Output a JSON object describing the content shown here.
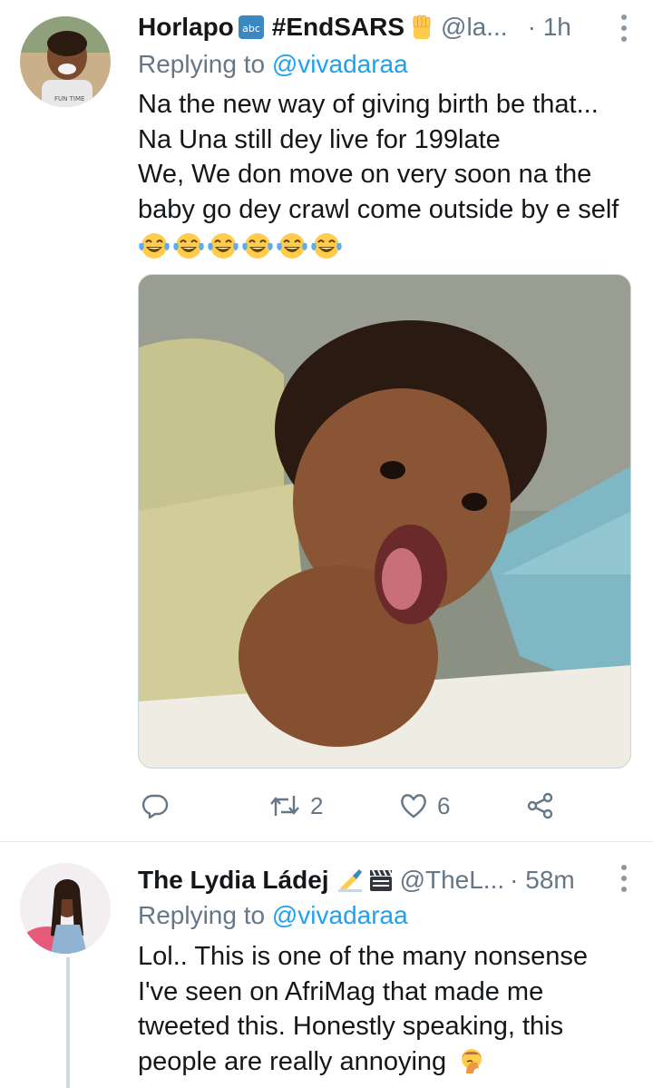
{
  "tweets": [
    {
      "author_name": "Horlapo",
      "name_badges": [
        "abc-icon",
        "raised-fist-icon"
      ],
      "hashtag": "#EndSARS",
      "handle": "@la...",
      "time": "· 1h",
      "replying_prefix": "Replying to",
      "replying_to": "@vivadaraa",
      "text_lines": [
        "Na the new way of giving birth be that...",
        "Na Una still dey live for 199late",
        "We, We don move on very soon na the",
        "baby go dey crawl come outside by e self"
      ],
      "emoji_row": [
        "tears-of-joy-emoji",
        "tears-of-joy-emoji",
        "tears-of-joy-emoji",
        "tears-of-joy-emoji",
        "tears-of-joy-emoji",
        "tears-of-joy-emoji"
      ],
      "media": "photo of a smiling curly-haired baby sticking out tongue",
      "actions": {
        "reply_count": "",
        "retweet_count": "2",
        "like_count": "6"
      }
    },
    {
      "author_name": "The Lydia Ládej",
      "name_badges": [
        "writing-hand-icon",
        "clapper-board-icon"
      ],
      "handle": "@TheL...",
      "time": "· 58m",
      "replying_prefix": "Replying to",
      "replying_to": "@vivadaraa",
      "text_lines": [
        "Lol.. This is one of the many nonsense",
        "I've seen on AfriMag that made me",
        "tweeted this. Honestly speaking, this",
        "people are really annoying"
      ],
      "trailing_emoji": "face-palm-emoji"
    }
  ],
  "colors": {
    "link_blue": "#1da1f2",
    "secondary_gray": "#657786",
    "divider": "#e1e8ed",
    "text": "#14171a"
  }
}
